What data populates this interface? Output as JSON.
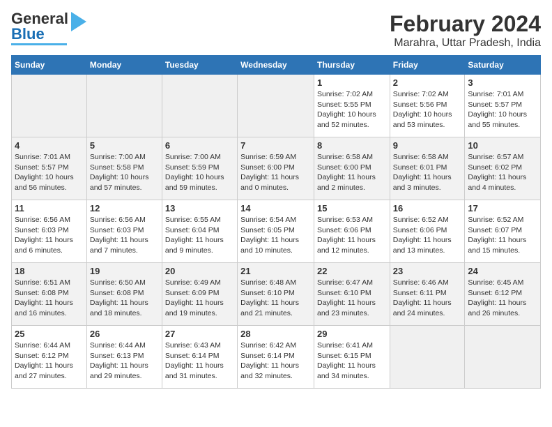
{
  "header": {
    "logo_general": "General",
    "logo_blue": "Blue",
    "title": "February 2024",
    "subtitle": "Marahra, Uttar Pradesh, India"
  },
  "days_of_week": [
    "Sunday",
    "Monday",
    "Tuesday",
    "Wednesday",
    "Thursday",
    "Friday",
    "Saturday"
  ],
  "weeks": [
    [
      {
        "day": "",
        "empty": true
      },
      {
        "day": "",
        "empty": true
      },
      {
        "day": "",
        "empty": true
      },
      {
        "day": "",
        "empty": true
      },
      {
        "day": "1",
        "sunrise": "7:02 AM",
        "sunset": "5:55 PM",
        "daylight": "10 hours and 52 minutes."
      },
      {
        "day": "2",
        "sunrise": "7:02 AM",
        "sunset": "5:56 PM",
        "daylight": "10 hours and 53 minutes."
      },
      {
        "day": "3",
        "sunrise": "7:01 AM",
        "sunset": "5:57 PM",
        "daylight": "10 hours and 55 minutes."
      }
    ],
    [
      {
        "day": "4",
        "sunrise": "7:01 AM",
        "sunset": "5:57 PM",
        "daylight": "10 hours and 56 minutes."
      },
      {
        "day": "5",
        "sunrise": "7:00 AM",
        "sunset": "5:58 PM",
        "daylight": "10 hours and 57 minutes."
      },
      {
        "day": "6",
        "sunrise": "7:00 AM",
        "sunset": "5:59 PM",
        "daylight": "10 hours and 59 minutes."
      },
      {
        "day": "7",
        "sunrise": "6:59 AM",
        "sunset": "6:00 PM",
        "daylight": "11 hours and 0 minutes."
      },
      {
        "day": "8",
        "sunrise": "6:58 AM",
        "sunset": "6:00 PM",
        "daylight": "11 hours and 2 minutes."
      },
      {
        "day": "9",
        "sunrise": "6:58 AM",
        "sunset": "6:01 PM",
        "daylight": "11 hours and 3 minutes."
      },
      {
        "day": "10",
        "sunrise": "6:57 AM",
        "sunset": "6:02 PM",
        "daylight": "11 hours and 4 minutes."
      }
    ],
    [
      {
        "day": "11",
        "sunrise": "6:56 AM",
        "sunset": "6:03 PM",
        "daylight": "11 hours and 6 minutes."
      },
      {
        "day": "12",
        "sunrise": "6:56 AM",
        "sunset": "6:03 PM",
        "daylight": "11 hours and 7 minutes."
      },
      {
        "day": "13",
        "sunrise": "6:55 AM",
        "sunset": "6:04 PM",
        "daylight": "11 hours and 9 minutes."
      },
      {
        "day": "14",
        "sunrise": "6:54 AM",
        "sunset": "6:05 PM",
        "daylight": "11 hours and 10 minutes."
      },
      {
        "day": "15",
        "sunrise": "6:53 AM",
        "sunset": "6:06 PM",
        "daylight": "11 hours and 12 minutes."
      },
      {
        "day": "16",
        "sunrise": "6:52 AM",
        "sunset": "6:06 PM",
        "daylight": "11 hours and 13 minutes."
      },
      {
        "day": "17",
        "sunrise": "6:52 AM",
        "sunset": "6:07 PM",
        "daylight": "11 hours and 15 minutes."
      }
    ],
    [
      {
        "day": "18",
        "sunrise": "6:51 AM",
        "sunset": "6:08 PM",
        "daylight": "11 hours and 16 minutes."
      },
      {
        "day": "19",
        "sunrise": "6:50 AM",
        "sunset": "6:08 PM",
        "daylight": "11 hours and 18 minutes."
      },
      {
        "day": "20",
        "sunrise": "6:49 AM",
        "sunset": "6:09 PM",
        "daylight": "11 hours and 19 minutes."
      },
      {
        "day": "21",
        "sunrise": "6:48 AM",
        "sunset": "6:10 PM",
        "daylight": "11 hours and 21 minutes."
      },
      {
        "day": "22",
        "sunrise": "6:47 AM",
        "sunset": "6:10 PM",
        "daylight": "11 hours and 23 minutes."
      },
      {
        "day": "23",
        "sunrise": "6:46 AM",
        "sunset": "6:11 PM",
        "daylight": "11 hours and 24 minutes."
      },
      {
        "day": "24",
        "sunrise": "6:45 AM",
        "sunset": "6:12 PM",
        "daylight": "11 hours and 26 minutes."
      }
    ],
    [
      {
        "day": "25",
        "sunrise": "6:44 AM",
        "sunset": "6:12 PM",
        "daylight": "11 hours and 27 minutes."
      },
      {
        "day": "26",
        "sunrise": "6:44 AM",
        "sunset": "6:13 PM",
        "daylight": "11 hours and 29 minutes."
      },
      {
        "day": "27",
        "sunrise": "6:43 AM",
        "sunset": "6:14 PM",
        "daylight": "11 hours and 31 minutes."
      },
      {
        "day": "28",
        "sunrise": "6:42 AM",
        "sunset": "6:14 PM",
        "daylight": "11 hours and 32 minutes."
      },
      {
        "day": "29",
        "sunrise": "6:41 AM",
        "sunset": "6:15 PM",
        "daylight": "11 hours and 34 minutes."
      },
      {
        "day": "",
        "empty": true
      },
      {
        "day": "",
        "empty": true
      }
    ]
  ],
  "labels": {
    "sunrise": "Sunrise:",
    "sunset": "Sunset:",
    "daylight": "Daylight:"
  }
}
